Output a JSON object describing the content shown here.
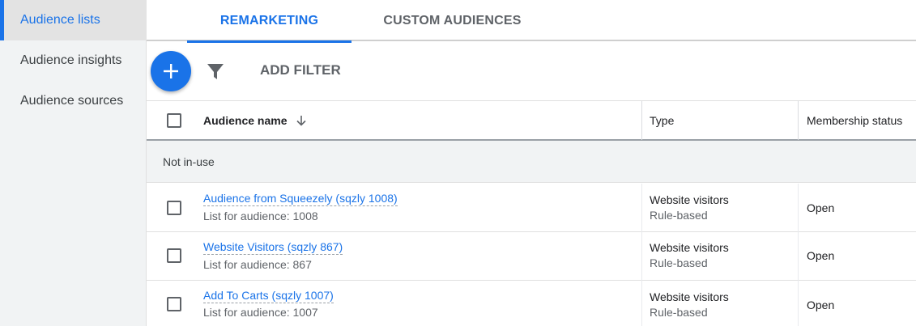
{
  "sidebar": {
    "items": [
      {
        "label": "Audience lists"
      },
      {
        "label": "Audience insights"
      },
      {
        "label": "Audience sources"
      }
    ]
  },
  "tabs": [
    {
      "label": "REMARKETING"
    },
    {
      "label": "CUSTOM AUDIENCES"
    }
  ],
  "toolbar": {
    "add_icon": "plus-icon",
    "filter_icon": "filter-icon",
    "add_filter_label": "ADD FILTER"
  },
  "table": {
    "columns": [
      {
        "label": "Audience name",
        "sort_icon": "arrow-down-icon"
      },
      {
        "label": "Type"
      },
      {
        "label": "Membership status"
      }
    ],
    "group_label": "Not in-use",
    "rows": [
      {
        "name": "Audience from Squeezely (sqzly 1008)",
        "subtitle": "List for audience: 1008",
        "type": "Website visitors",
        "type_sub": "Rule-based",
        "status": "Open"
      },
      {
        "name": "Website Visitors (sqzly 867)",
        "subtitle": "List for audience: 867",
        "type": "Website visitors",
        "type_sub": "Rule-based",
        "status": "Open"
      },
      {
        "name": "Add To Carts (sqzly 1007)",
        "subtitle": "List for audience: 1007",
        "type": "Website visitors",
        "type_sub": "Rule-based",
        "status": "Open"
      }
    ]
  },
  "colors": {
    "accent": "#1a73e8",
    "sidebar_bg": "#f1f3f4",
    "group_bg": "#f1f3f4"
  }
}
